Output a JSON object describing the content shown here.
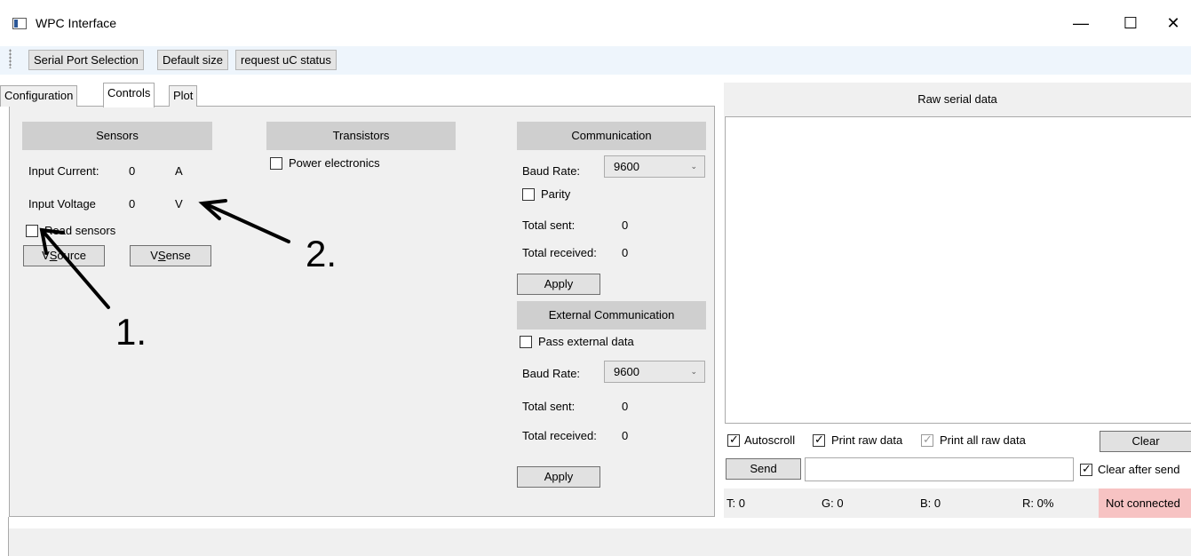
{
  "window": {
    "title": "WPC Interface",
    "minimize": "—",
    "maximize": "☐",
    "close": "✕"
  },
  "toolbar": {
    "serial_port": "Serial Port Selection",
    "default_size": "Default size",
    "request_status": "request uC status"
  },
  "tabs": [
    {
      "label": "Configuration"
    },
    {
      "label": "Controls"
    },
    {
      "label": "Plot"
    }
  ],
  "sensors": {
    "header": "Sensors",
    "input_current_label": "Input Current:",
    "input_current_value": "0",
    "input_current_unit": "A",
    "input_voltage_label": "Input Voltage",
    "input_voltage_value": "0",
    "input_voltage_unit": "V",
    "read_sensors": "Read sensors",
    "read_sensors_checked": false,
    "vsource_prefix": "V",
    "vsource_access": "S",
    "vsource_rest": "ource",
    "vsense_prefix": "V",
    "vsense_access": "S",
    "vsense_rest": "ense"
  },
  "transistors": {
    "header": "Transistors",
    "power_electronics": "Power electronics",
    "power_electronics_checked": false
  },
  "communication": {
    "header": "Communication",
    "baud_label": "Baud Rate:",
    "baud_value": "9600",
    "parity": "Parity",
    "parity_checked": false,
    "total_sent_label": "Total sent:",
    "total_sent_value": "0",
    "total_received_label": "Total received:",
    "total_received_value": "0",
    "apply": "Apply"
  },
  "external_communication": {
    "header": "External Communication",
    "pass_external": "Pass external data",
    "pass_external_checked": false,
    "baud_label": "Baud Rate:",
    "baud_value": "9600",
    "total_sent_label": "Total sent:",
    "total_sent_value": "0",
    "total_received_label": "Total received:",
    "total_received_value": "0",
    "apply": "Apply"
  },
  "raw": {
    "header": "Raw serial data",
    "autoscroll": "Autoscroll",
    "autoscroll_checked": true,
    "print_raw": "Print raw data",
    "print_raw_checked": true,
    "print_all_raw": "Print all raw data",
    "print_all_raw_checked": true,
    "clear": "Clear",
    "send": "Send",
    "send_value": "",
    "clear_after_send": "Clear after send",
    "clear_after_send_checked": true
  },
  "status": {
    "t": "T: 0",
    "g": "G: 0",
    "b": "B: 0",
    "r": "R: 0%",
    "connection": "Not connected",
    "connection_color": "#f7c3c3"
  },
  "annotations": {
    "one": "1.",
    "two": "2."
  }
}
